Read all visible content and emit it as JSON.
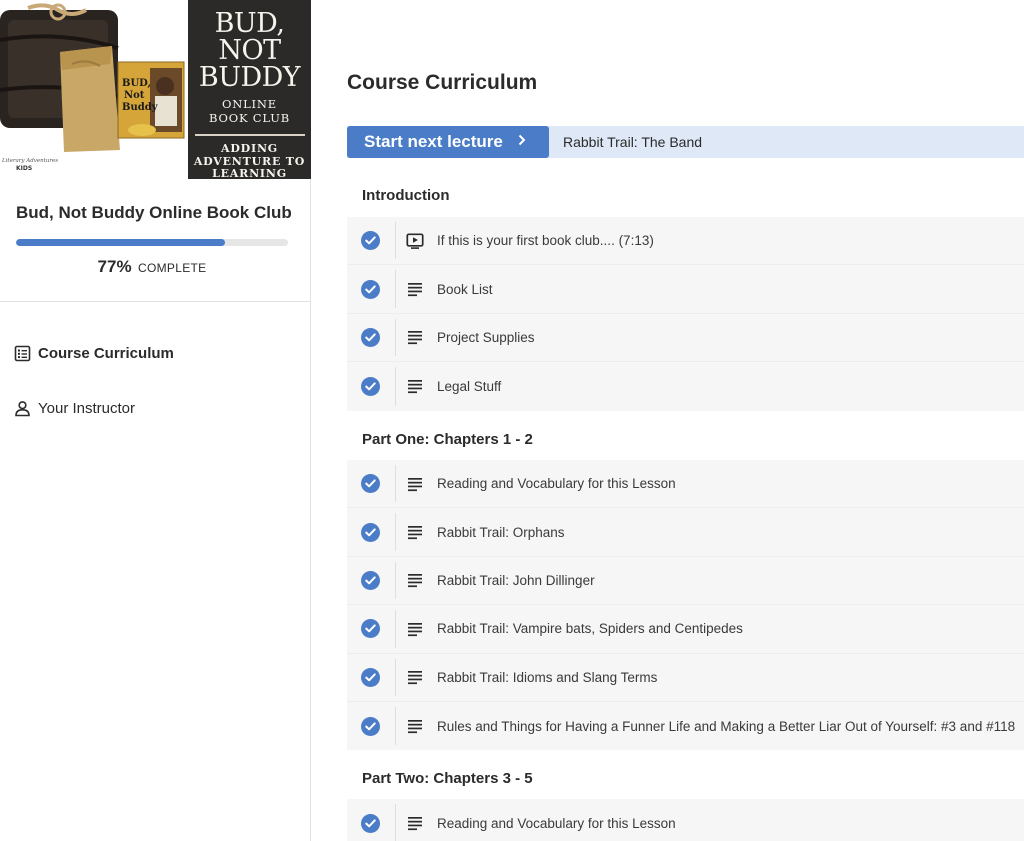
{
  "cover": {
    "title_line1": "BUD, NOT",
    "title_line2": "BUDDY",
    "sub_line1": "ONLINE",
    "sub_line2": "BOOK CLUB",
    "tag_line1": "ADDING",
    "tag_line2": "ADVENTURE TO",
    "tag_line3": "LEARNING",
    "book_line1": "BUD,",
    "book_line2": "Not",
    "book_line3": "Buddy",
    "brand_line1": "Literary Adventures",
    "brand_line2": "KIDS"
  },
  "course": {
    "title": "Bud, Not Buddy Online Book Club",
    "progress_percent": 77,
    "progress_label": "77%",
    "progress_word": "COMPLETE"
  },
  "nav": {
    "curriculum": "Course Curriculum",
    "instructor": "Your Instructor"
  },
  "main": {
    "page_title": "Course Curriculum",
    "start_button": "Start next lecture",
    "next_lecture": "Rabbit Trail: The Band"
  },
  "sections": [
    {
      "title": "Introduction",
      "items": [
        {
          "label": "If this is your first book club.... (7:13)",
          "icon": "video-icon"
        },
        {
          "label": "Book List",
          "icon": "text-lines-icon"
        },
        {
          "label": "Project Supplies",
          "icon": "text-lines-icon"
        },
        {
          "label": "Legal Stuff",
          "icon": "text-lines-icon"
        }
      ]
    },
    {
      "title": "Part One: Chapters 1 - 2",
      "items": [
        {
          "label": "Reading and Vocabulary for this Lesson",
          "icon": "text-lines-icon"
        },
        {
          "label": "Rabbit Trail: Orphans",
          "icon": "text-lines-icon"
        },
        {
          "label": "Rabbit Trail: John Dillinger",
          "icon": "text-lines-icon"
        },
        {
          "label": "Rabbit Trail: Vampire bats, Spiders and Centipedes",
          "icon": "text-lines-icon"
        },
        {
          "label": "Rabbit Trail: Idioms and Slang Terms",
          "icon": "text-lines-icon"
        },
        {
          "label": "Rules and Things for Having a Funner Life and Making a Better Liar Out of Yourself: #3 and #118",
          "icon": "text-lines-icon"
        }
      ]
    },
    {
      "title": "Part Two: Chapters 3 - 5",
      "items": [
        {
          "label": "Reading and Vocabulary for this Lesson",
          "icon": "text-lines-icon"
        }
      ]
    }
  ],
  "colors": {
    "accent": "#4a7cc8",
    "next_bar_bg": "#dfe8f6",
    "row_bg": "#f6f6f6",
    "cover_panel": "#2b2a28"
  }
}
